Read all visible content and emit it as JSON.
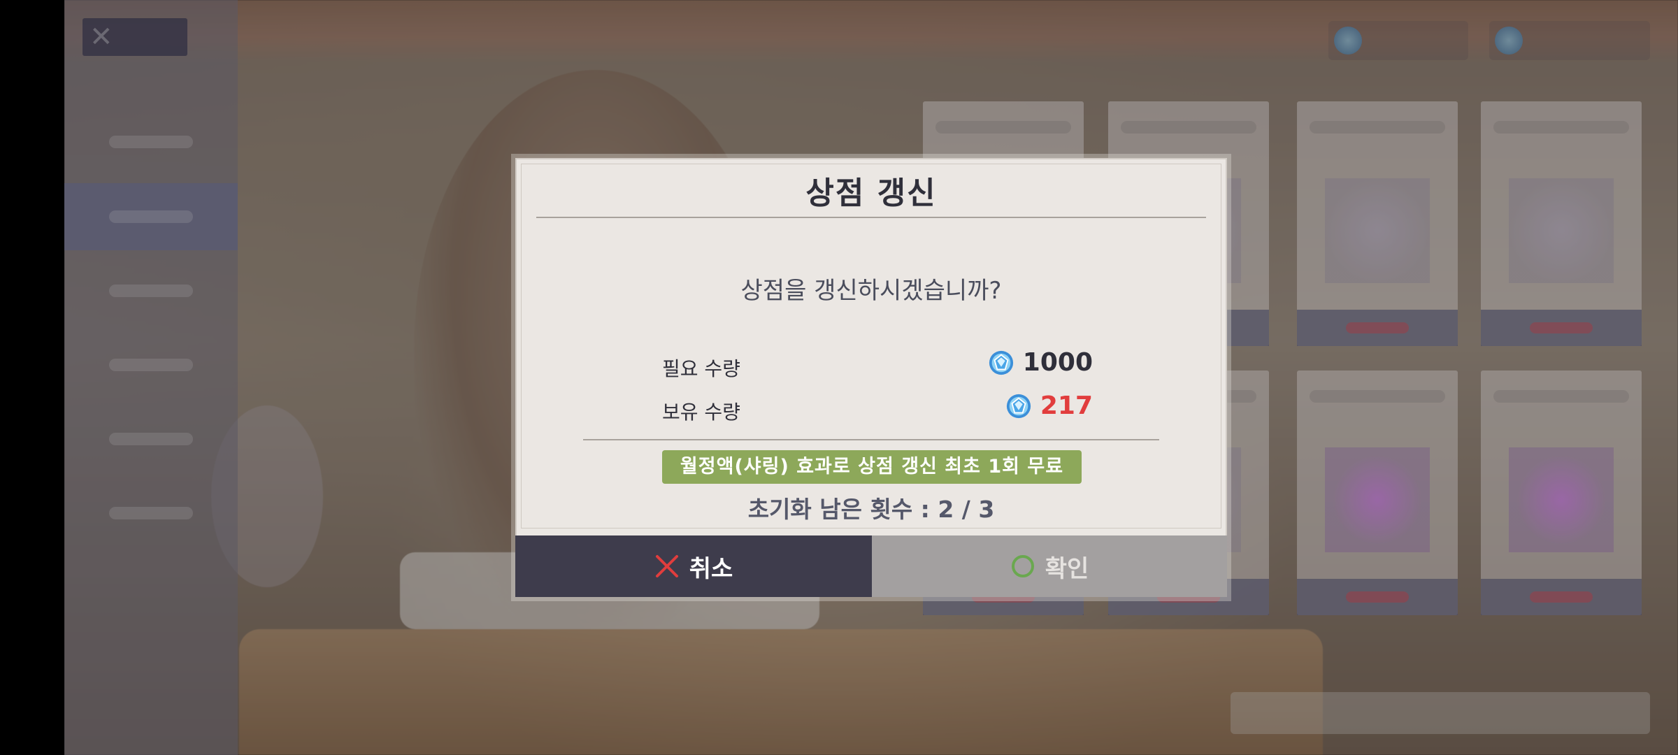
{
  "dialog": {
    "title": "상점 갱신",
    "question": "상점을 갱신하시겠습니까?",
    "required": {
      "label": "필요 수량",
      "value": "1000",
      "icon": "gem-icon"
    },
    "owned": {
      "label": "보유 수량",
      "value": "217",
      "icon": "gem-icon",
      "color": "#e13d3d"
    },
    "bonus_text": "월정액(샤링) 효과로 상점 갱신 최초 1회 무료",
    "reset_count": "초기화 남은 횟수 : 2 / 3",
    "cancel_label": "취소",
    "confirm_label": "확인"
  },
  "colors": {
    "banner": "#8da85a",
    "cancel_button": "#3e3c4c",
    "confirm_button": "#a3a0a0",
    "cancel_icon": "#e13d3d",
    "confirm_icon": "#6aa84f"
  }
}
